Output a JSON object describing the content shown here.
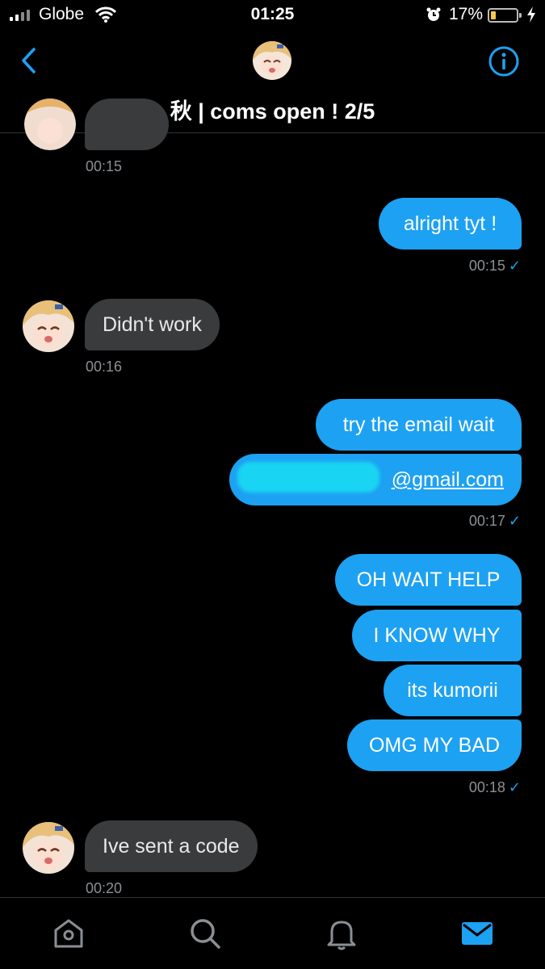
{
  "status_bar": {
    "carrier": "Globe",
    "time": "01:25",
    "battery_percent": "17%",
    "battery_level": 0.17,
    "icons": [
      "signal-icon",
      "wifi-icon",
      "alarm-icon",
      "battery-icon",
      "charging-bolt-icon"
    ]
  },
  "header": {
    "title": "秋 | coms open ! 2/5",
    "icons": [
      "back-chevron-icon",
      "avatar",
      "info-icon"
    ]
  },
  "messages": {
    "m0_time": "00:15",
    "m1_text": "alright tyt !",
    "m1_time": "00:15",
    "m2_text": "Didn't work",
    "m2_time": "00:16",
    "m3_text": "try the email wait",
    "m4_text": "@gmail.com",
    "m4_time": "00:17",
    "m5_text": "OH WAIT HELP",
    "m6_text": "I KNOW WHY",
    "m7_text": "its kumorii",
    "m8_text": "OMG MY BAD",
    "m8_time": "00:18",
    "m9_text": "Ive sent a code",
    "m9_time": "00:20",
    "check_mark": "✓"
  },
  "tab_bar": {
    "icons": [
      "home-icon",
      "search-icon",
      "notifications-bell-icon",
      "messages-envelope-icon"
    ],
    "active": "messages-envelope-icon"
  },
  "colors": {
    "background": "#000000",
    "outgoing_bubble": "#1da1f2",
    "incoming_bubble": "#3a3b3d",
    "accent": "#1da1f2",
    "timestamp": "#8b8f94"
  }
}
